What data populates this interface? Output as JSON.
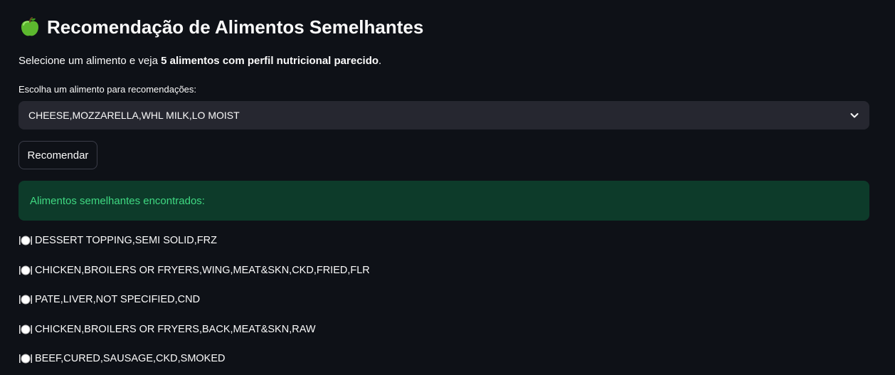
{
  "header": {
    "icon": "green-apple-icon",
    "title": "Recomendação de Alimentos Semelhantes"
  },
  "intro": {
    "text_before": "Selecione um alimento e veja ",
    "text_bold": "5 alimentos com perfil nutricional parecido",
    "text_after": "."
  },
  "selector": {
    "label": "Escolha um alimento para recomendações:",
    "value": "CHEESE,MOZZARELLA,WHL MILK,LO MOIST",
    "icon": "chevron-down-icon"
  },
  "actions": {
    "recommend_label": "Recomendar"
  },
  "result": {
    "success_message": "Alimentos semelhantes encontrados:",
    "item_icon": "fork-knife-plate-icon",
    "items": [
      "DESSERT TOPPING,SEMI SOLID,FRZ",
      "CHICKEN,BROILERS OR FRYERS,WING,MEAT&SKN,CKD,FRIED,FLR",
      "PATE,LIVER,NOT SPECIFIED,CND",
      "CHICKEN,BROILERS OR FRYERS,BACK,MEAT&SKN,RAW",
      "BEEF,CURED,SAUSAGE,CKD,SMOKED"
    ]
  },
  "colors": {
    "background": "#0e1117",
    "input_background": "#262730",
    "success_background": "#0d3b2a",
    "success_text": "#3fd982"
  }
}
